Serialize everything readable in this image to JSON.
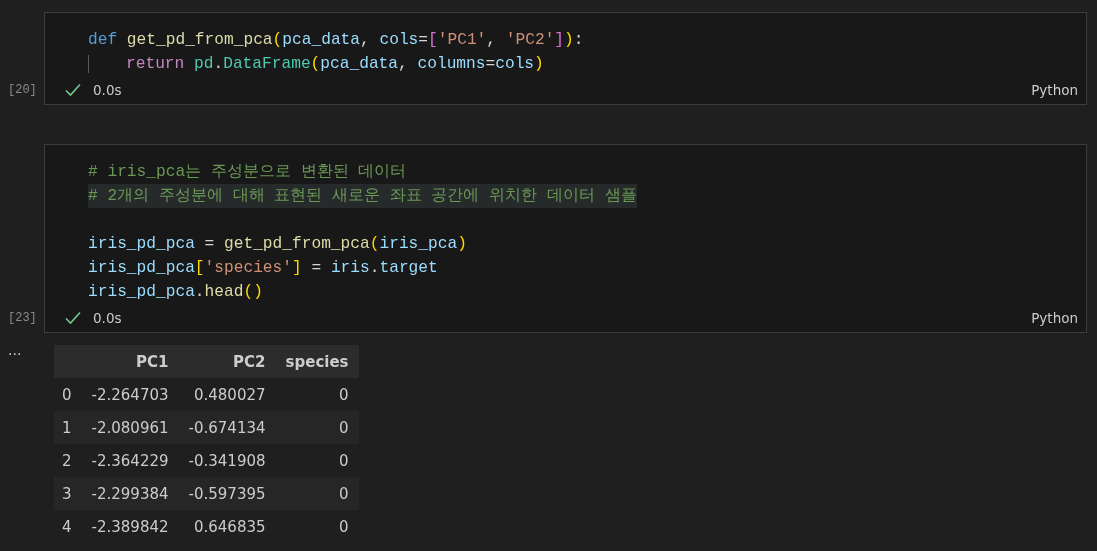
{
  "cells": [
    {
      "execution_count": "[20]",
      "success": true,
      "time": "0.0s",
      "language": "Python",
      "lines": [
        {
          "tokens": [
            {
              "kind": "keyword",
              "text": "def"
            },
            {
              "kind": "function",
              "text": " get_pd_from_pca"
            },
            {
              "kind": "bracket1",
              "text": "("
            },
            {
              "kind": "variable",
              "text": "pca_data"
            },
            {
              "kind": "plain",
              "text": ", "
            },
            {
              "kind": "variable",
              "text": "cols"
            },
            {
              "kind": "plain",
              "text": "="
            },
            {
              "kind": "bracket2",
              "text": "["
            },
            {
              "kind": "string",
              "text": "'PC1'"
            },
            {
              "kind": "plain",
              "text": ", "
            },
            {
              "kind": "string",
              "text": "'PC2'"
            },
            {
              "kind": "bracket2",
              "text": "]"
            },
            {
              "kind": "bracket1",
              "text": ")"
            },
            {
              "kind": "plain",
              "text": ":"
            }
          ]
        },
        {
          "indent": true,
          "tokens": [
            {
              "kind": "control",
              "text": "return"
            },
            {
              "kind": "class",
              "text": " pd"
            },
            {
              "kind": "plain",
              "text": "."
            },
            {
              "kind": "class",
              "text": "DataFrame"
            },
            {
              "kind": "bracket1",
              "text": "("
            },
            {
              "kind": "variable",
              "text": "pca_data"
            },
            {
              "kind": "plain",
              "text": ", "
            },
            {
              "kind": "variable",
              "text": "columns"
            },
            {
              "kind": "plain",
              "text": "="
            },
            {
              "kind": "variable",
              "text": "cols"
            },
            {
              "kind": "bracket1",
              "text": ")"
            }
          ]
        }
      ]
    },
    {
      "execution_count": "[23]",
      "success": true,
      "time": "0.0s",
      "language": "Python",
      "lines": [
        {
          "tokens": [
            {
              "kind": "comment",
              "text": "# iris_pca는 주성분으로 변환된 데이터"
            }
          ]
        },
        {
          "highlighted": true,
          "tokens": [
            {
              "kind": "comment",
              "text": "# 2개의 주성분에 대해 표현된 새로운 좌표 공간에 위치한 데이터 샘플"
            }
          ]
        },
        {
          "blank_before": true,
          "tokens": [
            {
              "kind": "variable",
              "text": "iris_pd_pca"
            },
            {
              "kind": "plain",
              "text": " = "
            },
            {
              "kind": "function",
              "text": "get_pd_from_pca"
            },
            {
              "kind": "bracket1",
              "text": "("
            },
            {
              "kind": "variable",
              "text": "iris_pca"
            },
            {
              "kind": "bracket1",
              "text": ")"
            }
          ]
        },
        {
          "tokens": [
            {
              "kind": "variable",
              "text": "iris_pd_pca"
            },
            {
              "kind": "bracket1",
              "text": "["
            },
            {
              "kind": "string",
              "text": "'species'"
            },
            {
              "kind": "bracket1",
              "text": "]"
            },
            {
              "kind": "plain",
              "text": " = "
            },
            {
              "kind": "variable",
              "text": "iris"
            },
            {
              "kind": "plain",
              "text": "."
            },
            {
              "kind": "variable",
              "text": "target"
            }
          ]
        },
        {
          "tokens": [
            {
              "kind": "variable",
              "text": "iris_pd_pca"
            },
            {
              "kind": "plain",
              "text": "."
            },
            {
              "kind": "function",
              "text": "head"
            },
            {
              "kind": "bracket1",
              "text": "()"
            }
          ]
        }
      ],
      "output": {
        "menu": "...",
        "table": {
          "columns": [
            "",
            "PC1",
            "PC2",
            "species"
          ],
          "rows": [
            [
              "0",
              "-2.264703",
              "0.480027",
              "0"
            ],
            [
              "1",
              "-2.080961",
              "-0.674134",
              "0"
            ],
            [
              "2",
              "-2.364229",
              "-0.341908",
              "0"
            ],
            [
              "3",
              "-2.299384",
              "-0.597395",
              "0"
            ],
            [
              "4",
              "-2.389842",
              "0.646835",
              "0"
            ]
          ]
        }
      }
    }
  ]
}
